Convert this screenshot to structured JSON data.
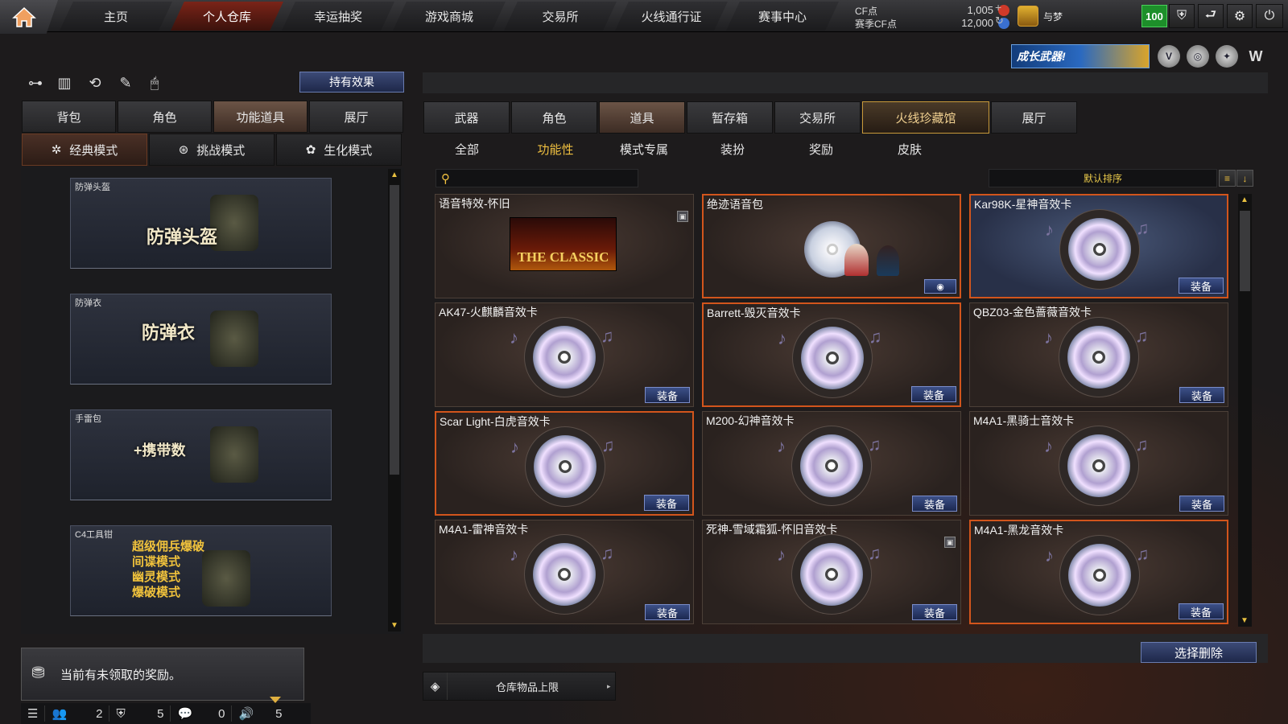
{
  "nav": {
    "tabs": [
      "主页",
      "个人仓库",
      "幸运抽奖",
      "游戏商城",
      "交易所",
      "火线通行证",
      "赛事中心"
    ],
    "active_index": 1
  },
  "currency": {
    "cf_label": "CF点",
    "cf_value": "1,005",
    "season_label": "赛季CF点",
    "season_value": "12,000"
  },
  "user": {
    "name": "与梦",
    "level": "100"
  },
  "banner": {
    "text": "成长武器!"
  },
  "left": {
    "effect_button": "持有效果",
    "tabs": [
      "背包",
      "角色",
      "功能道具",
      "展厅"
    ],
    "active_tab": 2,
    "mode_tabs": [
      "经典模式",
      "挑战模式",
      "生化模式"
    ],
    "active_mode": 0,
    "cards": [
      {
        "title": "防弹头盔",
        "big": "防弹头盔"
      },
      {
        "title": "防弹衣",
        "big": "防弹衣"
      },
      {
        "title": "手雷包",
        "big": "+携带数"
      },
      {
        "title": "C4工具钳",
        "lines": [
          "超级佣兵爆破",
          "间谍模式",
          "幽灵模式",
          "爆破模式"
        ]
      }
    ]
  },
  "right": {
    "tabs": [
      "武器",
      "角色",
      "道具",
      "暂存箱",
      "交易所",
      "火线珍藏馆",
      "展厅"
    ],
    "active_tab": 2,
    "highlight_tab": 5,
    "subtabs": [
      "全部",
      "功能性",
      "模式专属",
      "装扮",
      "奖励",
      "皮肤"
    ],
    "active_subtab": 1,
    "sort_label": "默认排序",
    "equip_label": "装备",
    "classic_text": "THE CLASSIC",
    "items": [
      {
        "name": "语音特效-怀旧",
        "kind": "classic",
        "border": "none",
        "equip": false,
        "lock": true
      },
      {
        "name": "绝迹语音包",
        "kind": "voice",
        "border": "orange",
        "equip": false,
        "lock": false
      },
      {
        "name": "Kar98K-星神音效卡",
        "kind": "disc",
        "border": "selected",
        "equip": true,
        "lock": false
      },
      {
        "name": "AK47-火麒麟音效卡",
        "kind": "disc",
        "border": "none",
        "equip": true,
        "lock": false
      },
      {
        "name": "Barrett-毁灭音效卡",
        "kind": "disc",
        "border": "orange",
        "equip": true,
        "lock": false
      },
      {
        "name": "QBZ03-金色蔷薇音效卡",
        "kind": "disc",
        "border": "none",
        "equip": true,
        "lock": false
      },
      {
        "name": "Scar Light-白虎音效卡",
        "kind": "disc",
        "border": "orange",
        "equip": true,
        "lock": false
      },
      {
        "name": "M200-幻神音效卡",
        "kind": "disc",
        "border": "none",
        "equip": true,
        "lock": false
      },
      {
        "name": "M4A1-黑骑士音效卡",
        "kind": "disc",
        "border": "none",
        "equip": true,
        "lock": false
      },
      {
        "name": "M4A1-雷神音效卡",
        "kind": "disc",
        "border": "none",
        "equip": true,
        "lock": false
      },
      {
        "name": "死神-雪域霜狐-怀旧音效卡",
        "kind": "disc",
        "border": "none",
        "equip": true,
        "lock": true
      },
      {
        "name": "M4A1-黑龙音效卡",
        "kind": "disc",
        "border": "orange",
        "equip": true,
        "lock": false
      }
    ],
    "delete_button": "选择删除",
    "capacity_label": "仓库物品上限"
  },
  "bottom": {
    "reward_text": "当前有未领取的奖励。",
    "status": {
      "friends": "2",
      "clan": "5",
      "messages": "0",
      "volume": "5"
    }
  }
}
